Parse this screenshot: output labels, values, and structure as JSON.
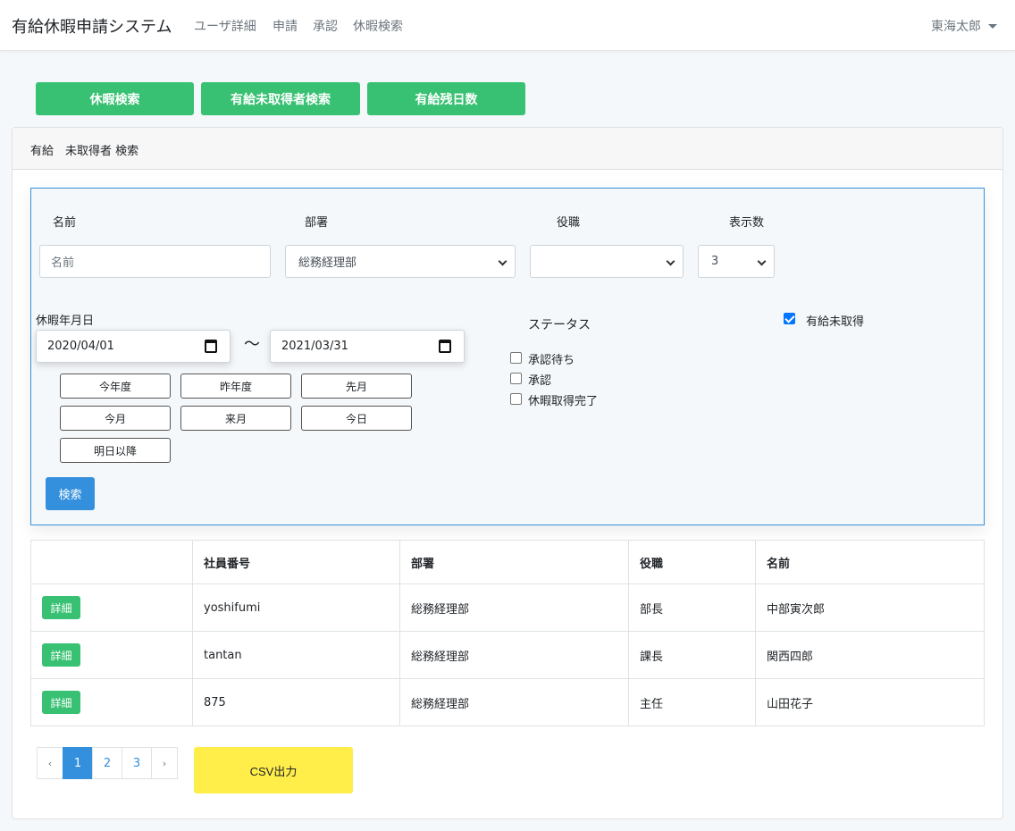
{
  "navbar": {
    "brand": "有給休暇申請システム",
    "links": [
      "ユーザ詳細",
      "申請",
      "承認",
      "休暇検索"
    ],
    "user": "東海太郎"
  },
  "tabs": [
    "休暇検索",
    "有給未取得者検索",
    "有給残日数"
  ],
  "card": {
    "title": "有給　未取得者 検索"
  },
  "form": {
    "name_label": "名前",
    "name_placeholder": "名前",
    "dept_label": "部署",
    "dept_value": "総務経理部",
    "position_label": "役職",
    "position_value": "",
    "count_label": "表示数",
    "count_value": "3",
    "date_label": "休暇年月日",
    "date_from": "2020/04/01",
    "date_separator": "～",
    "date_to": "2021/03/31",
    "quick_buttons": [
      "今年度",
      "昨年度",
      "先月",
      "今月",
      "来月",
      "今日",
      "明日以降"
    ],
    "status_label": "ステータス",
    "statuses": [
      {
        "label": "承認待ち",
        "checked": false
      },
      {
        "label": "承認",
        "checked": false
      },
      {
        "label": "休暇取得完了",
        "checked": false
      }
    ],
    "unused_label": "有給未取得",
    "unused_checked": true,
    "search_label": "検索"
  },
  "table": {
    "headers": [
      "",
      "社員番号",
      "部署",
      "役職",
      "名前"
    ],
    "detail_label": "詳細",
    "rows": [
      {
        "id": "yoshifumi",
        "dept": "総務経理部",
        "position": "部長",
        "name": "中部寅次郎"
      },
      {
        "id": "tantan",
        "dept": "総務経理部",
        "position": "課長",
        "name": "関西四郎"
      },
      {
        "id": "875",
        "dept": "総務経理部",
        "position": "主任",
        "name": "山田花子"
      }
    ]
  },
  "pagination": {
    "prev": "‹",
    "pages": [
      "1",
      "2",
      "3"
    ],
    "current": "1",
    "next": "›"
  },
  "csv_label": "CSV出力",
  "colors": {
    "green": "#38c172",
    "blue": "#3490dc",
    "yellow": "#ffed4a"
  }
}
